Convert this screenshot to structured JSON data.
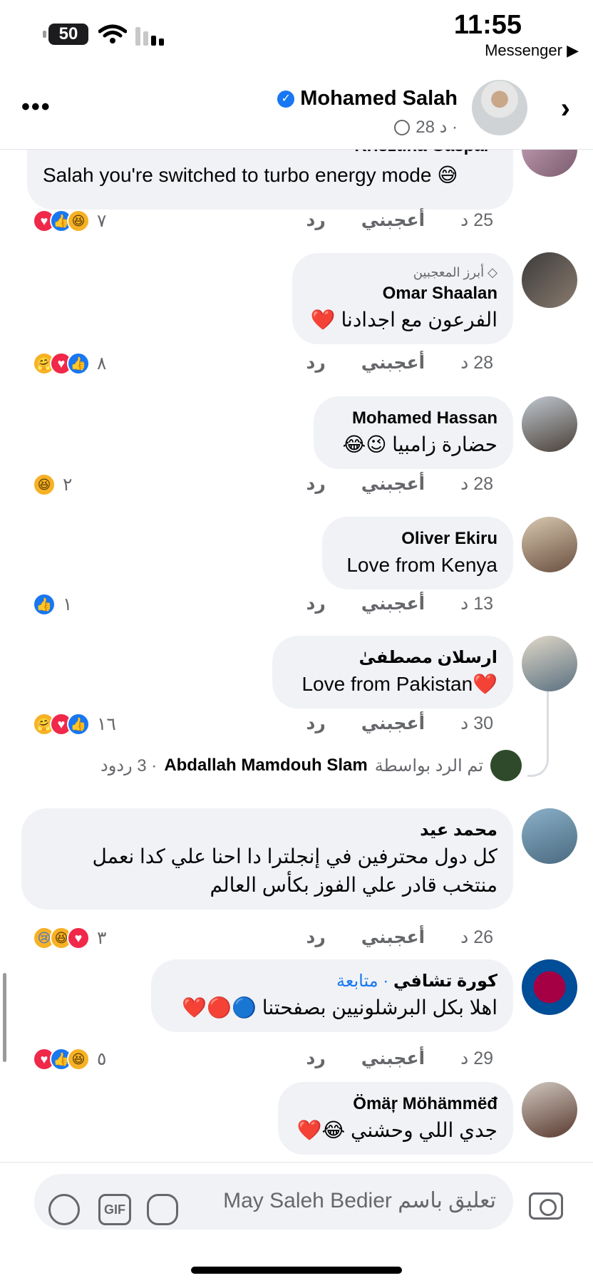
{
  "status_bar": {
    "battery": "50",
    "time": "11:55",
    "back_app": "Messenger"
  },
  "header": {
    "name": "Mohamed Salah",
    "subtitle": "28 د ·",
    "more_label": "•••",
    "next_label": "›"
  },
  "comments": [
    {
      "name": "Krisztina Gaspar",
      "text": "Salah you're switched to turbo energy mode 😅",
      "time": "25 د",
      "like": "أعجبني",
      "reply": "رد",
      "reaction_count": "٧",
      "reactions": [
        "love",
        "like",
        "haha"
      ]
    },
    {
      "badge": "أبرز المعجبين",
      "name": "Omar Shaalan",
      "text": "الفرعون مع اجدادنا ❤️",
      "time": "28 د",
      "like": "أعجبني",
      "reply": "رد",
      "reaction_count": "٨",
      "reactions": [
        "care",
        "love",
        "like"
      ]
    },
    {
      "name": "Mohamed Hassan",
      "text": "حضارة زامبيا 😉😂",
      "time": "28 د",
      "like": "أعجبني",
      "reply": "رد",
      "reaction_count": "٢",
      "reactions": [
        "haha"
      ]
    },
    {
      "name": "Oliver Ekiru",
      "text": "Love from Kenya",
      "time": "13 د",
      "like": "أعجبني",
      "reply": "رد",
      "reaction_count": "١",
      "reactions": [
        "like"
      ]
    },
    {
      "name": "ارسلان مصطفیٰ",
      "text": "Love from Pakistan❤️",
      "time": "30 د",
      "like": "أعجبني",
      "reply": "رد",
      "reaction_count": "١٦",
      "reactions": [
        "care",
        "love",
        "like"
      ],
      "replies": {
        "prefix": "تم الرد بواسطة",
        "by": "Abdallah Mamdouh Slam",
        "count": "· 3 ردود"
      }
    },
    {
      "name": "محمد عيد",
      "text": "كل دول محترفين في إنجلترا دا احنا علي كدا نعمل منتخب قادر علي الفوز بكأس العالم",
      "time": "26 د",
      "like": "أعجبني",
      "reply": "رد",
      "reaction_count": "٣",
      "reactions": [
        "sad",
        "haha",
        "love"
      ]
    },
    {
      "name": "كورة  تشافي",
      "follow": "· متابعة",
      "text": "اهلا بكل البرشلونيين بصفحتنا 🔵🔴❤️",
      "time": "29 د",
      "like": "أعجبني",
      "reply": "رد",
      "reaction_count": "٥",
      "reactions": [
        "love",
        "like",
        "haha"
      ]
    },
    {
      "name": "Ömäŗ Möhämmëđ",
      "text": "جدي اللي وحشني 😂❤️"
    }
  ],
  "composer": {
    "placeholder": "تعليق باسم May Saleh Bedier",
    "gif_label": "GIF"
  },
  "colors": {
    "accent": "#1877f2",
    "love": "#f02849",
    "bubble": "#f0f2f5"
  }
}
